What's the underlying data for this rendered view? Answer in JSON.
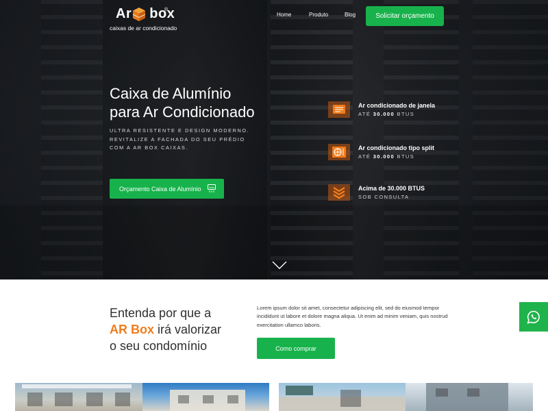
{
  "header": {
    "logo_text_left": "Ar",
    "logo_text_right": "box",
    "logo_registered": "®",
    "logo_tagline": "caixas de ar condicionado",
    "nav": [
      "Home",
      "Produto",
      "Blog"
    ],
    "cta_label": "Solicitar orçamento"
  },
  "hero": {
    "title_line1": "Caixa de Alumínio",
    "title_line2": "para Ar Condicionado",
    "subtitle": "ULTRA RESISTENTE E DESIGN MODERNO. REVITALIZE A FACHADA DO SEU PRÉDIO COM A AR BOX CAIXAS.",
    "button_label": "Orçamento Caixa de Alumínio",
    "features": [
      {
        "title": "Ar condicionado de janela",
        "sub_prefix": "ATÉ ",
        "sub_value": "30.000",
        "sub_suffix": " BTUS",
        "icon": "window-ac-icon"
      },
      {
        "title": "Ar condicionado tipo split",
        "sub_prefix": "ATÉ ",
        "sub_value": "30.000",
        "sub_suffix": " BTUS",
        "icon": "split-ac-icon"
      },
      {
        "title": "Acima de 30.000 BTUS",
        "sub_prefix": "SOB CONSULTA",
        "sub_value": "",
        "sub_suffix": "",
        "icon": "large-ac-icon"
      }
    ]
  },
  "why": {
    "title_line1": "Entenda por que a",
    "title_accent": "AR Box",
    "title_line2_rest": " irá valorizar",
    "title_line3": "o seu condomínio",
    "text": "Lorem ipsum dolor sit amet, consectetur adipiscing elit, sed do eiusmod tempor incididunt ut labore et dolore magna aliqua. Ut enim ad minim veniam, quis nostrud exercitation ullamco laboris.",
    "button_label": "Como comprar"
  },
  "colors": {
    "accent_green": "#18b24c",
    "accent_orange": "#f07c1b",
    "whatsapp_green": "#20b34b"
  }
}
